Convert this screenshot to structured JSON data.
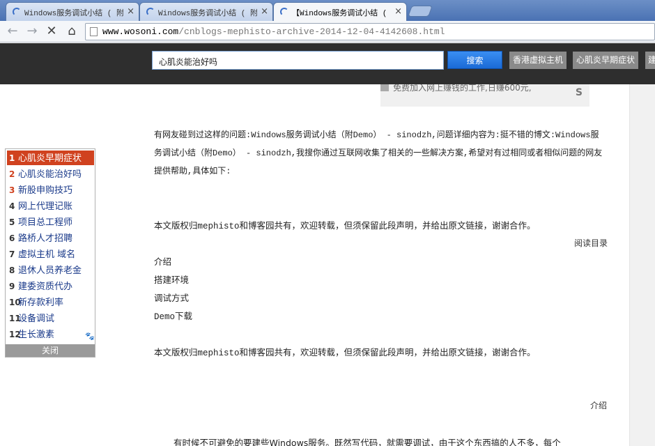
{
  "browser": {
    "tabs": [
      {
        "title": "Windows服务调试小结 ( 附"
      },
      {
        "title": "Windows服务调试小结 ( 附"
      },
      {
        "title": "【Windows服务调试小结 ("
      }
    ],
    "url_host": "www.wosoni.com",
    "url_path": "/cnblogs-mephisto-archive-2014-12-04-4142608.html"
  },
  "site_header": {
    "search_value": "心肌炎能治好吗",
    "search_button": "搜索",
    "hot_links": [
      "香港虚拟主机",
      "心肌炎早期症状",
      "建"
    ]
  },
  "ad": {
    "text": "免费加入网上赚钱的工作,日赚600元,",
    "logo": "S"
  },
  "article": {
    "intro": "有网友碰到过这样的问题:Windows服务调试小结（附Demo） - sinodzh,问题详细内容为:挺不错的博文:Windows服务调试小结（附Demo） - sinodzh,我搜你通过互联网收集了相关的一些解决方案,希望对有过相同或者相似问题的网友提供帮助,具体如下:",
    "copyright_1": "本文版权归mephisto和博客园共有，欢迎转载，但须保留此段声明，并给出原文链接，谢谢合作。",
    "read_toc": "阅读目录",
    "toc": [
      "介绍",
      "搭建环境",
      "调试方式",
      "Demo下载"
    ],
    "copyright_2": "本文版权归mephisto和博客园共有，欢迎转载，但须保留此段声明，并给出原文链接，谢谢合作。",
    "section_label": "介绍",
    "last_line": "有时候不可避免的要建些Windows服务。既然写代码，就需要调试，由于这个东西搞的人不多，每个"
  },
  "hot_search": {
    "items": [
      {
        "num": "1",
        "label": "心肌炎早期症状"
      },
      {
        "num": "2",
        "label": "心肌炎能治好吗"
      },
      {
        "num": "3",
        "label": "新股申购技巧"
      },
      {
        "num": "4",
        "label": "网上代理记账"
      },
      {
        "num": "5",
        "label": "项目总工程师"
      },
      {
        "num": "6",
        "label": "路桥人才招聘"
      },
      {
        "num": "7",
        "label": "虚拟主机 域名"
      },
      {
        "num": "8",
        "label": "退休人员养老金"
      },
      {
        "num": "9",
        "label": "建委资质代办"
      },
      {
        "num": "10",
        "label": "新存款利率"
      },
      {
        "num": "11",
        "label": "设备调试"
      },
      {
        "num": "12",
        "label": "生长激素"
      }
    ],
    "close": "关闭"
  }
}
